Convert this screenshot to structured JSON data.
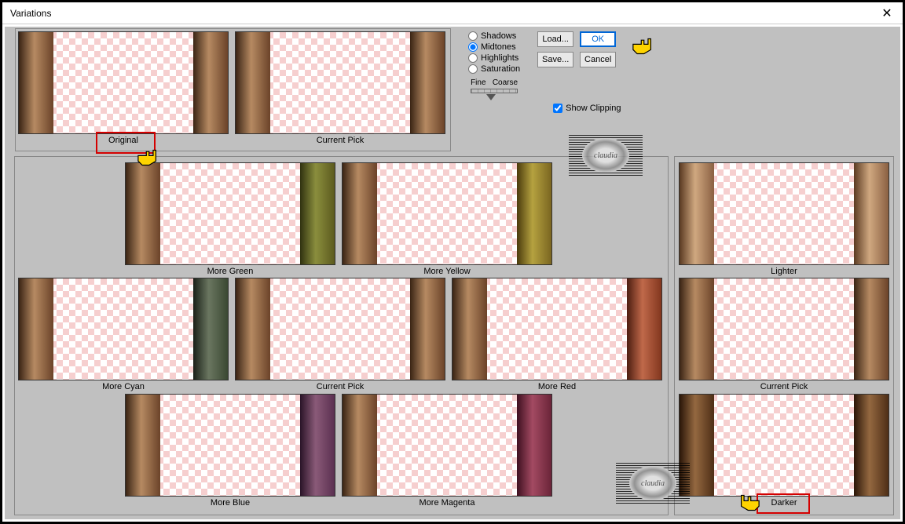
{
  "window": {
    "title": "Variations"
  },
  "controls": {
    "radios": {
      "shadows": "Shadows",
      "midtones": "Midtones",
      "highlights": "Highlights",
      "saturation": "Saturation",
      "selected": "midtones"
    },
    "slider": {
      "fine": "Fine",
      "coarse": "Coarse"
    },
    "buttons": {
      "load": "Load...",
      "ok": "OK",
      "save": "Save...",
      "cancel": "Cancel"
    },
    "showClipping": {
      "label": "Show Clipping",
      "checked": true
    }
  },
  "thumbs": {
    "original": "Original",
    "currentPickTop": "Current Pick",
    "moreGreen": "More Green",
    "moreYellow": "More Yellow",
    "moreCyan": "More Cyan",
    "currentPickMid": "Current Pick",
    "moreRed": "More Red",
    "moreBlue": "More Blue",
    "moreMagenta": "More Magenta",
    "lighter": "Lighter",
    "currentPickRight": "Current Pick",
    "darker": "Darker"
  },
  "watermark": "claudia"
}
